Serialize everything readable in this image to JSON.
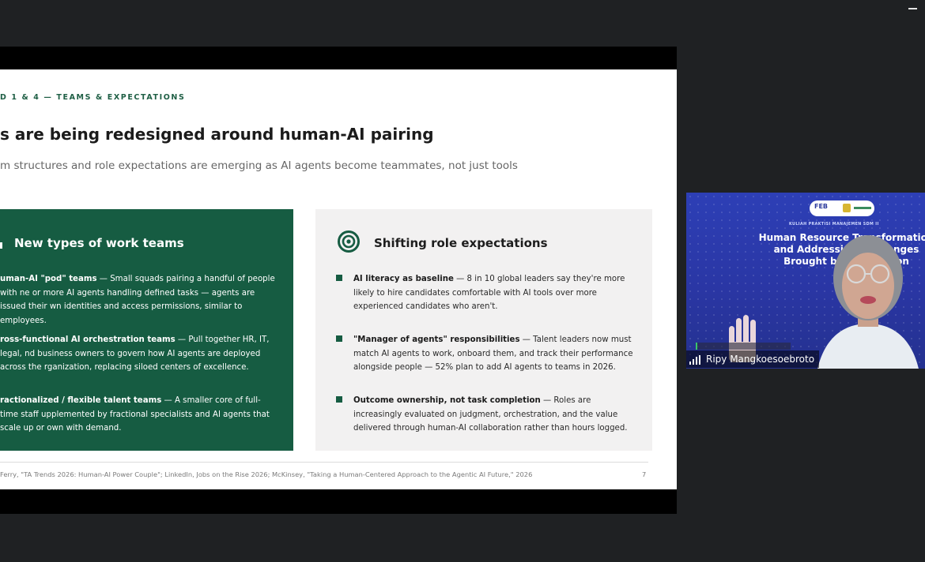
{
  "window": {
    "minimize_icon": "minimize-icon"
  },
  "slide": {
    "eyebrow": "D 1 & 4 — TEAMS & EXPECTATIONS",
    "title": "s are being redesigned around human-AI pairing",
    "subtitle": "m structures and role expectations are emerging as AI agents become teammates, not just tools",
    "left_card": {
      "heading": "New types of work teams",
      "items": [
        {
          "bold": "uman-AI \"pod\" teams",
          "text": " — Small squads pairing a handful of people with ne or more AI agents handling defined tasks — agents are issued their wn identities and access permissions, similar to employees."
        },
        {
          "bold": "ross-functional AI orchestration teams",
          "text": " — Pull together HR, IT, legal, nd business owners to govern how AI agents are deployed across the rganization, replacing siloed centers of excellence."
        },
        {
          "bold": "ractionalized / flexible talent teams",
          "text": " — A smaller core of full-time staff upplemented by fractional specialists and AI agents that scale up or own with demand."
        }
      ]
    },
    "right_card": {
      "heading": "Shifting role expectations",
      "icon": "target-icon",
      "items": [
        {
          "bold": "AI literacy as baseline",
          "text": " — 8 in 10 global leaders say they're more likely to hire candidates comfortable with AI tools over more experienced candidates who aren't."
        },
        {
          "bold": "\"Manager of agents\" responsibilities",
          "text": " — Talent leaders now must match AI agents to work, onboard them, and track their performance alongside people — 52% plan to add AI agents to teams in 2026."
        },
        {
          "bold": "Outcome ownership, not task completion",
          "text": " — Roles are increasingly evaluated on judgment, orchestration, and the value delivered through human-AI collaboration rather than hours logged."
        }
      ]
    },
    "footer": "Ferry, \"TA Trends 2026: Human-AI Power Couple\"; LinkedIn, Jobs on the Rise 2026; McKinsey, \"Taking a Human-Centered Approach to the Agentic AI Future,\" 2026",
    "page_number": "7",
    "colors": {
      "accent_green": "#165c42",
      "card_grey": "#f2f1f1"
    }
  },
  "video": {
    "logo_text": "FEB",
    "small_caption": "KULIAH PRAKTISI MANAJEMEN SDM II",
    "title_lines": [
      "Human Resource Transformation",
      "and Addressing Challenges",
      "Brought by AI Adoption"
    ],
    "participant_name": "Ripy Mangkoesoebroto",
    "signal_icon": "signal-strength-icon",
    "background_color": "#2d3fb6"
  }
}
